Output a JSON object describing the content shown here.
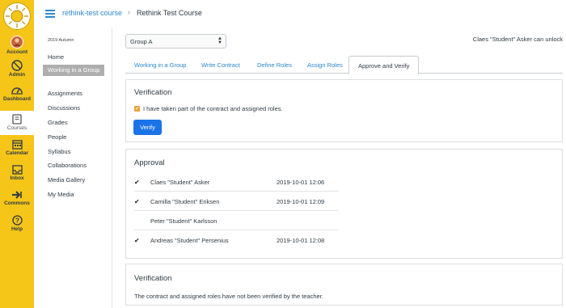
{
  "global_nav": {
    "items": [
      {
        "label": "Account",
        "icon": "account-avatar-icon"
      },
      {
        "label": "Admin",
        "icon": "shield-icon"
      },
      {
        "label": "Dashboard",
        "icon": "dashboard-gauge-icon"
      },
      {
        "label": "Courses",
        "icon": "book-icon"
      },
      {
        "label": "Calendar",
        "icon": "calendar-icon"
      },
      {
        "label": "Inbox",
        "icon": "inbox-icon"
      },
      {
        "label": "Commons",
        "icon": "commons-arrow-icon"
      },
      {
        "label": "Help",
        "icon": "help-question-icon"
      }
    ],
    "colors": {
      "background": "#f5c518",
      "active_background": "#ffffff"
    }
  },
  "breadcrumb": {
    "course_link": "rethink-test course",
    "separator": "›",
    "current": "Rethink Test Course"
  },
  "course_nav": {
    "term": "2019 Autumn",
    "items": [
      {
        "label": "Home"
      },
      {
        "label": "Working in a Group"
      },
      {
        "label": "Assignments"
      },
      {
        "label": "Discussions"
      },
      {
        "label": "Grades"
      },
      {
        "label": "People"
      },
      {
        "label": "Syllabus"
      },
      {
        "label": "Collaborations"
      },
      {
        "label": "Media Gallery"
      },
      {
        "label": "My Media"
      }
    ],
    "active": "Working in a Group"
  },
  "group_select": {
    "value": "Group A"
  },
  "unlock_text": "Claes \"Student\" Asker can unlock",
  "tabs": [
    {
      "label": "Working in a Group"
    },
    {
      "label": "Write Contract"
    },
    {
      "label": "Define Roles"
    },
    {
      "label": "Assign Roles"
    },
    {
      "label": "Approve and Verify"
    }
  ],
  "active_tab": "Approve and Verify",
  "verification_student": {
    "title": "Verification",
    "checkbox_label": "I have taken part of the contract and assigned roles.",
    "checked": true,
    "button_label": "Verify"
  },
  "approval": {
    "title": "Approval",
    "rows": [
      {
        "tick": "✔",
        "name": "Claes \"Student\" Asker",
        "date": "2019-10-01 12:06"
      },
      {
        "tick": "✔",
        "name": "Camilla \"Student\" Eriksen",
        "date": "2019-10-01 12:09"
      },
      {
        "tick": "",
        "name": "Peter \"Student\" Karlsson",
        "date": ""
      },
      {
        "tick": "✔",
        "name": "Andreas \"Student\" Persenius",
        "date": "2019-10-01 12:08"
      }
    ]
  },
  "verification_teacher": {
    "title": "Verification",
    "note": "The contract and assigned roles have not been verified by the teacher."
  },
  "colors": {
    "link": "#2c88d0",
    "button": "#1b73e8",
    "checkbox": "#e8a33a",
    "text": "#2d3b45"
  }
}
